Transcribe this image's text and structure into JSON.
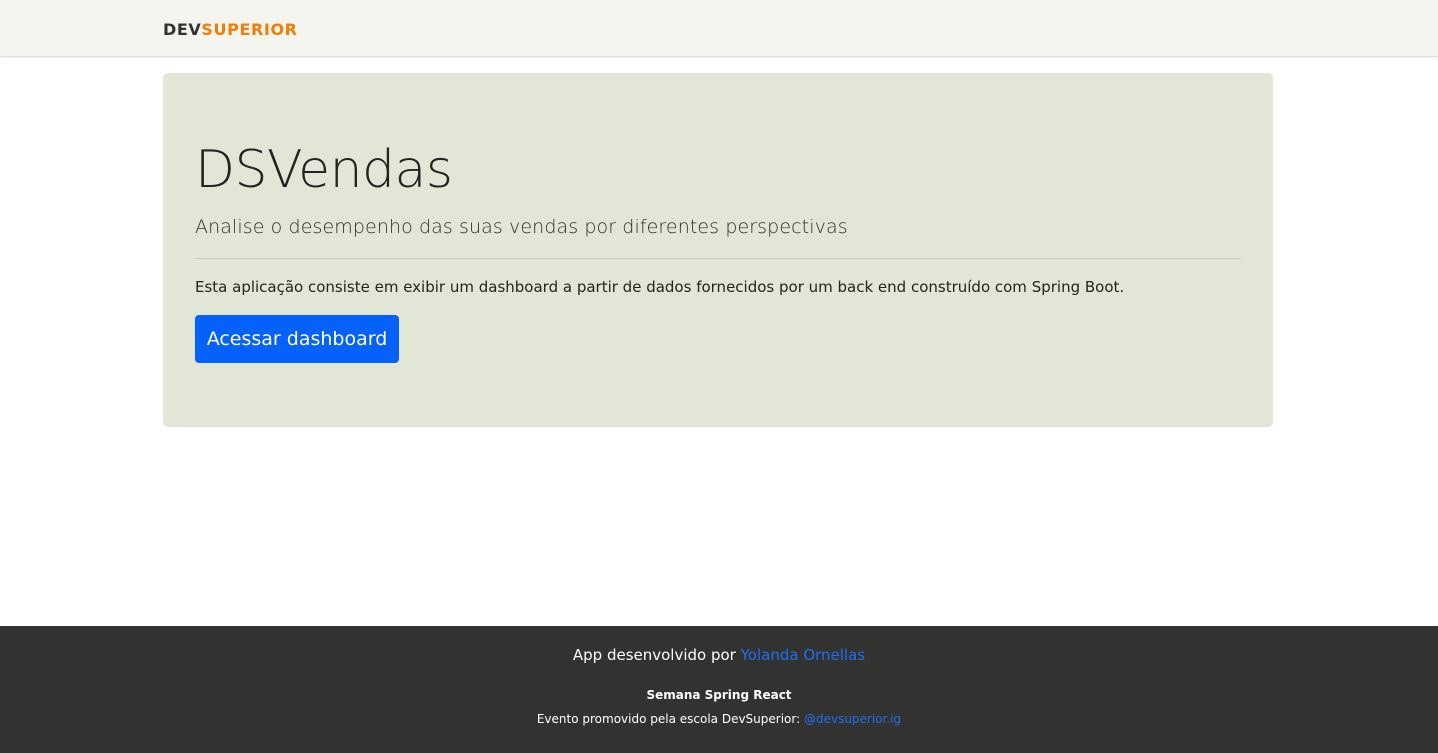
{
  "header": {
    "logo_part1": "DEV",
    "logo_part2": "SUPERIOR",
    "brand_colors": {
      "dark": "#323231",
      "orange": "#ef7e07"
    }
  },
  "jumbotron": {
    "title": "DSVendas",
    "lead": "Analise o desempenho das suas vendas por diferentes perspectivas",
    "description": "Esta aplicação consiste em exibir um dashboard a partir de dados fornecidos por um back end construído com Spring Boot.",
    "button_label": "Acessar dashboard",
    "background_color": "#e2e6d6",
    "button_color": "#0461fa"
  },
  "footer": {
    "developed_by_prefix": "App desenvolvido por ",
    "developer_name": "Yolanda Ornellas",
    "event_title": "Semana Spring React",
    "event_text_prefix": "Evento promovido pela escola DevSuperior: ",
    "event_handle": "@devsuperior.ig",
    "background_color": "#323330",
    "link_color": "#1f6ff2"
  }
}
